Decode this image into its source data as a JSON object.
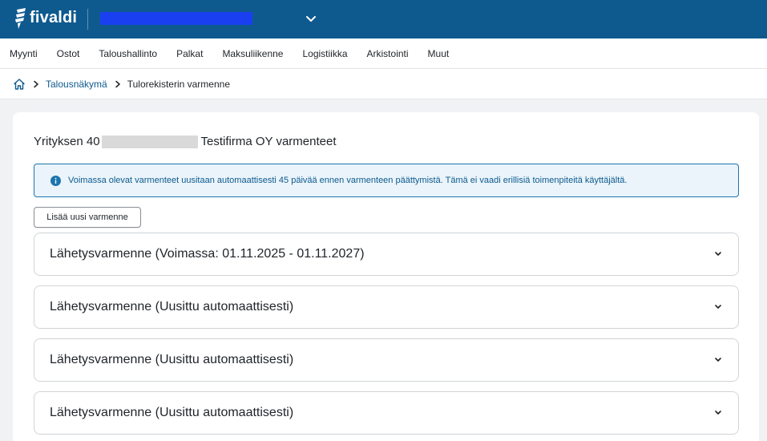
{
  "app": {
    "logo_text": "fivaldi"
  },
  "nav": {
    "items": [
      "Myynti",
      "Ostot",
      "Taloushallinto",
      "Palkat",
      "Maksuliikenne",
      "Logistiikka",
      "Arkistointi",
      "Muut"
    ]
  },
  "breadcrumb": {
    "link": "Talousnäkymä",
    "current": "Tulorekisterin varmenne"
  },
  "page": {
    "title_prefix": "Yrityksen 40",
    "title_suffix": "Testifirma OY varmenteet",
    "info_text": "Voimassa olevat varmenteet uusitaan automaattisesti 45 päivää ennen varmenteen päättymistä. Tämä ei vaadi erillisiä toimenpiteitä käyttäjältä.",
    "add_button_label": "Lisää uusi varmenne"
  },
  "accordions": [
    {
      "label": "Lähetysvarmenne (Voimassa: 01.11.2025 - 01.11.2027)"
    },
    {
      "label": "Lähetysvarmenne (Uusittu automaattisesti)"
    },
    {
      "label": "Lähetysvarmenne (Uusittu automaattisesti)"
    },
    {
      "label": "Lähetysvarmenne (Uusittu automaattisesti)"
    }
  ],
  "colors": {
    "brand": "#0e5a8f",
    "info_bg": "#eaf4fa",
    "info_border": "#1c75ad"
  },
  "icons": [
    "fivaldi-logo-icon",
    "chevron-down-icon",
    "home-icon",
    "chevron-right-icon",
    "info-icon"
  ]
}
